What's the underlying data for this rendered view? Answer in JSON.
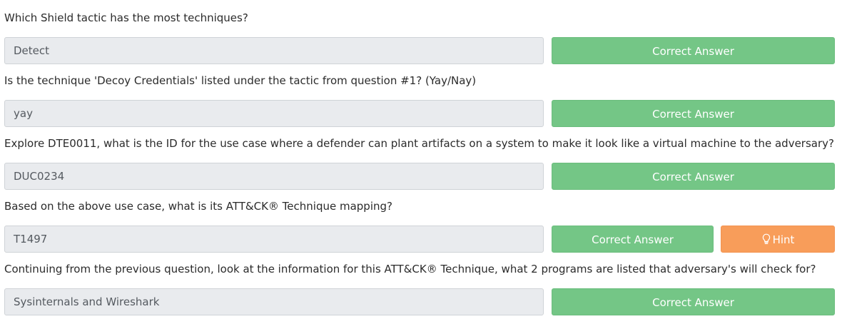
{
  "questions": [
    {
      "text": "Which Shield tactic has the most techniques?",
      "answer": "Detect",
      "button_label": "Correct Answer"
    },
    {
      "text": "Is the technique 'Decoy Credentials' listed under the tactic from question #1? (Yay/Nay)",
      "answer": "yay",
      "button_label": "Correct Answer"
    },
    {
      "text": "Explore DTE0011, what is the ID for the use case where a defender can plant artifacts on a system to make it look like a virtual machine to the adversary?",
      "answer": "DUC0234",
      "button_label": "Correct Answer"
    },
    {
      "text": "Based on the above use case, what is its ATT&CK® Technique mapping?",
      "answer": "T1497",
      "button_label": "Correct Answer",
      "hint_label": "Hint",
      "hint_icon": "lightbulb-icon"
    },
    {
      "text": "Continuing from the previous question, look at the information for this ATT&CK® Technique, what 2 programs are listed that adversary's will check for?",
      "answer": "Sysinternals and Wireshark",
      "button_label": "Correct Answer"
    }
  ],
  "colors": {
    "correct_button": "#74c686",
    "hint_button": "#f89d5a",
    "input_background": "#e9ebee"
  }
}
